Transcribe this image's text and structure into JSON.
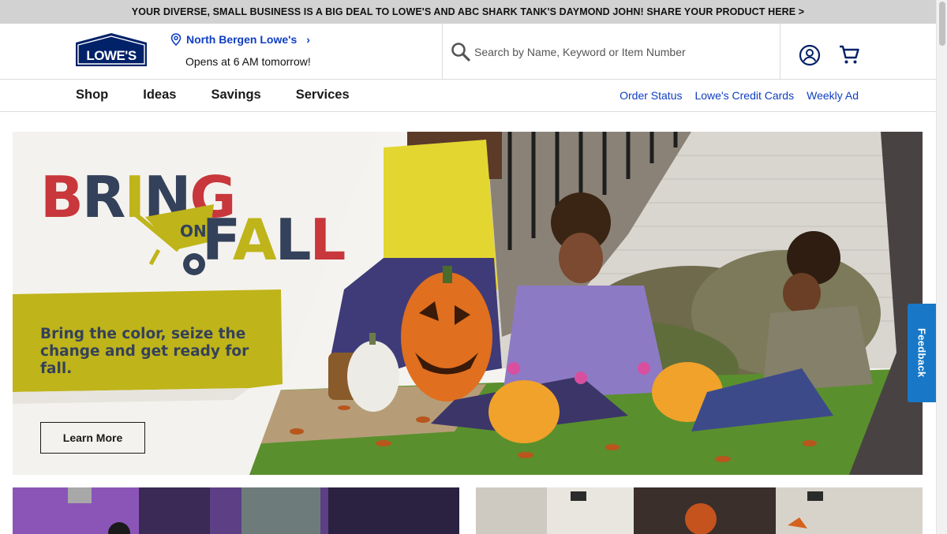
{
  "promo_banner": {
    "text": "YOUR DIVERSE, SMALL BUSINESS IS A BIG DEAL TO LOWE'S AND ABC SHARK TANK'S DAYMOND JOHN! SHARE YOUR PRODUCT HERE >"
  },
  "header": {
    "logo_text": "LOWE'S",
    "store_name": "North Bergen Lowe's",
    "store_hours": "Opens at 6 AM tomorrow!",
    "search_placeholder": "Search by Name, Keyword or Item Number",
    "icons": [
      "pin-icon",
      "chevron-right-icon",
      "search-icon",
      "account-icon",
      "cart-icon"
    ]
  },
  "nav": {
    "items": [
      {
        "label": "Shop"
      },
      {
        "label": "Ideas"
      },
      {
        "label": "Savings"
      },
      {
        "label": "Services"
      }
    ],
    "links": [
      {
        "label": "Order Status"
      },
      {
        "label": "Lowe's Credit Cards"
      },
      {
        "label": "Weekly Ad"
      }
    ]
  },
  "hero": {
    "headline_word_1": "BRING",
    "headline_word_2": "ON",
    "headline_word_3": "FALL",
    "tagline": "Bring the color, seize the change and get ready for fall.",
    "cta_label": "Learn More"
  },
  "feedback": {
    "label": "Feedback"
  },
  "colors": {
    "brand_blue": "#012169",
    "link_blue": "#0f3ec2",
    "feedback_blue": "#1878c7",
    "headline_red": "#c8373b",
    "headline_navy": "#34415a",
    "headline_olive": "#bfb41a"
  }
}
